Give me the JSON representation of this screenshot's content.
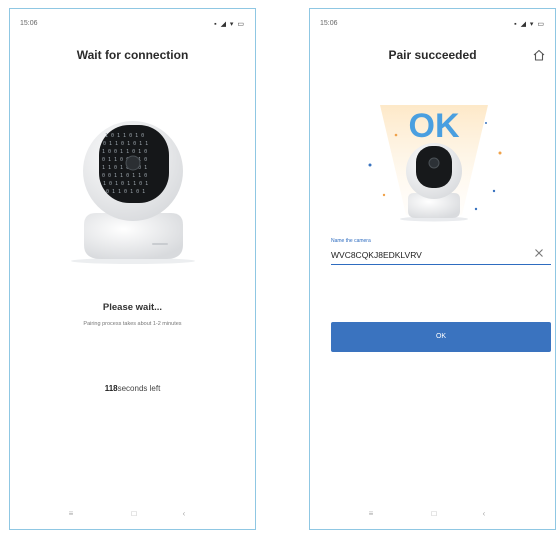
{
  "colors": {
    "accent": "#3a73bf",
    "frame": "#8fc7e3"
  },
  "screens": {
    "left": {
      "status_time": "15:06",
      "status_icons": "▪ ◢ ▾ ▭",
      "title": "Wait for connection",
      "wait_title": "Please wait...",
      "wait_subtitle": "Pairing process takes about 1-2 minutes",
      "countdown_number": "118",
      "countdown_suffix": "seconds left",
      "nav": {
        "menu": "≡",
        "home": "□",
        "back": "‹"
      }
    },
    "right": {
      "status_time": "15:06",
      "status_icons": "▪ ◢ ▾ ▭",
      "title": "Pair succeeded",
      "ok_badge": "OK",
      "name_label": "Name the camera",
      "camera_name": "WVC8CQKJ8EDKLVRV",
      "ok_button": "OK",
      "nav": {
        "menu": "≡",
        "home": "□",
        "back": "‹"
      }
    }
  }
}
